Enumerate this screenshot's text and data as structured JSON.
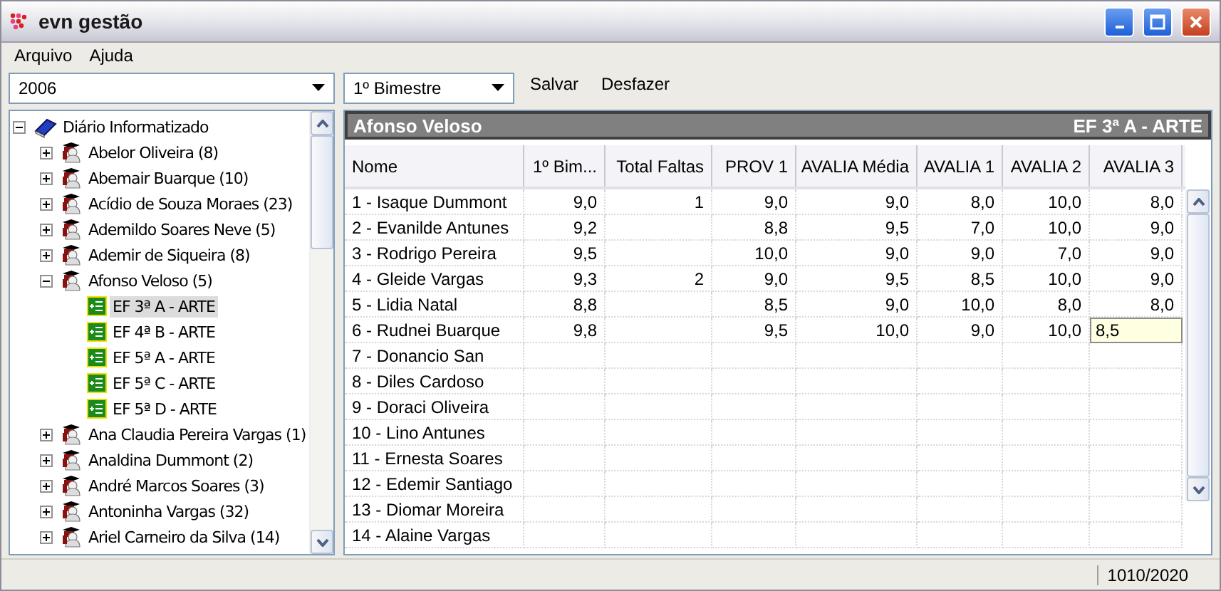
{
  "window": {
    "title": "evn gestão"
  },
  "menu": [
    "Arquivo",
    "Ajuda"
  ],
  "year_select": {
    "value": "2006"
  },
  "period_select": {
    "value": "1º Bimestre"
  },
  "toolbar": [
    "Salvar",
    "Desfazer"
  ],
  "tree": {
    "items": [
      {
        "label": "Diário Informatizado",
        "kind": "root",
        "expanded": true,
        "selected": false,
        "children": [
          {
            "label": "Abelor Oliveira (8)",
            "kind": "teacher",
            "expanded": false,
            "selected": false
          },
          {
            "label": "Abemair Buarque (10)",
            "kind": "teacher",
            "expanded": false,
            "selected": false
          },
          {
            "label": "Acídio de Souza Moraes (23)",
            "kind": "teacher",
            "expanded": false,
            "selected": false
          },
          {
            "label": "Ademildo Soares Neve (5)",
            "kind": "teacher",
            "expanded": false,
            "selected": false
          },
          {
            "label": "Ademir de Siqueira (8)",
            "kind": "teacher",
            "expanded": false,
            "selected": false
          },
          {
            "label": "Afonso Veloso (5)",
            "kind": "teacher",
            "expanded": true,
            "selected": false,
            "children": [
              {
                "label": "EF 3ª A - ARTE",
                "kind": "class",
                "selected": true
              },
              {
                "label": "EF 4ª B - ARTE",
                "kind": "class",
                "selected": false
              },
              {
                "label": "EF 5ª A - ARTE",
                "kind": "class",
                "selected": false
              },
              {
                "label": "EF 5ª C - ARTE",
                "kind": "class",
                "selected": false
              },
              {
                "label": "EF 5ª D - ARTE",
                "kind": "class",
                "selected": false
              }
            ]
          },
          {
            "label": "Ana Claudia Pereira Vargas (1)",
            "kind": "teacher",
            "expanded": false,
            "selected": false
          },
          {
            "label": "Analdina Dummont (2)",
            "kind": "teacher",
            "expanded": false,
            "selected": false
          },
          {
            "label": "André Marcos Soares (3)",
            "kind": "teacher",
            "expanded": false,
            "selected": false
          },
          {
            "label": "Antoninha Vargas (32)",
            "kind": "teacher",
            "expanded": false,
            "selected": false
          },
          {
            "label": "Ariel Carneiro da Silva (14)",
            "kind": "teacher",
            "expanded": false,
            "selected": false
          }
        ]
      }
    ]
  },
  "grid": {
    "teacher": "Afonso Veloso",
    "class": "EF 3ª A - ARTE",
    "columns": [
      "Nome",
      "1º Bim...",
      "Total Faltas",
      "PROV 1",
      "AVALIA Média",
      "AVALIA 1",
      "AVALIA 2",
      "AVALIA 3"
    ],
    "rows": [
      {
        "cells": [
          "1 - Isaque Dummont",
          "9,0",
          "1",
          "9,0",
          "9,0",
          "8,0",
          "10,0",
          "8,0"
        ]
      },
      {
        "cells": [
          "2 - Evanilde Antunes",
          "9,2",
          "",
          "8,8",
          "9,5",
          "7,0",
          "10,0",
          "9,0"
        ]
      },
      {
        "cells": [
          "3 - Rodrigo Pereira",
          "9,5",
          "",
          "10,0",
          "9,0",
          "9,0",
          "7,0",
          "9,0"
        ]
      },
      {
        "cells": [
          "4 - Gleide Vargas",
          "9,3",
          "2",
          "9,0",
          "9,5",
          "8,5",
          "10,0",
          "9,0"
        ]
      },
      {
        "cells": [
          "5 - Lidia Natal",
          "8,8",
          "",
          "8,5",
          "9,0",
          "10,0",
          "8,0",
          "8,0"
        ]
      },
      {
        "cells": [
          "6 - Rudnei Buarque",
          "9,8",
          "",
          "9,5",
          "10,0",
          "9,0",
          "10,0",
          {
            "value": "8,5",
            "editing": true
          }
        ]
      },
      {
        "cells": [
          "7 - Donancio San",
          "",
          "",
          "",
          "",
          "",
          "",
          ""
        ]
      },
      {
        "cells": [
          "8 - Diles Cardoso",
          "",
          "",
          "",
          "",
          "",
          "",
          ""
        ]
      },
      {
        "cells": [
          "9 - Doraci Oliveira",
          "",
          "",
          "",
          "",
          "",
          "",
          ""
        ]
      },
      {
        "cells": [
          "10 - Lino Antunes",
          "",
          "",
          "",
          "",
          "",
          "",
          ""
        ]
      },
      {
        "cells": [
          "11 - Ernesta Soares",
          "",
          "",
          "",
          "",
          "",
          "",
          ""
        ]
      },
      {
        "cells": [
          "12 - Edemir Santiago",
          "",
          "",
          "",
          "",
          "",
          "",
          ""
        ]
      },
      {
        "cells": [
          "13 - Diomar Moreira",
          "",
          "",
          "",
          "",
          "",
          "",
          ""
        ]
      },
      {
        "cells": [
          "14 - Alaine Vargas",
          "",
          "",
          "",
          "",
          "",
          "",
          ""
        ]
      }
    ]
  },
  "status_bar": {
    "text": "1010/2020"
  }
}
